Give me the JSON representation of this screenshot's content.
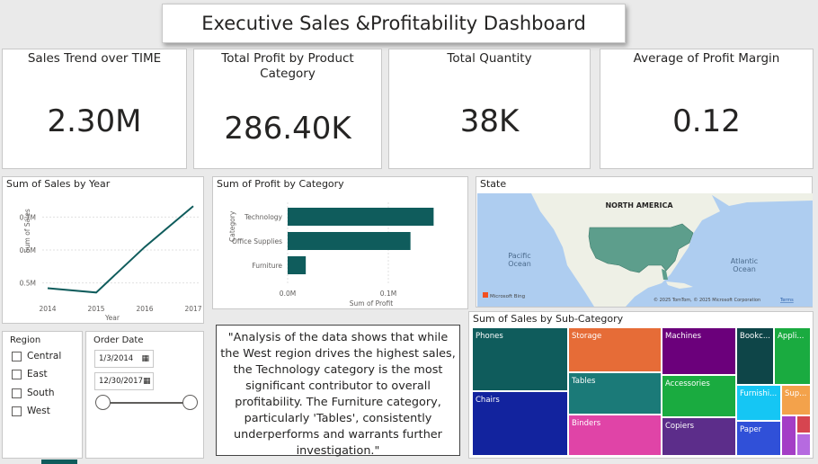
{
  "header": {
    "title": "Executive Sales &Profitability Dashboard"
  },
  "kpis": [
    {
      "label": "Sales Trend over TIME",
      "value": "2.30M"
    },
    {
      "label": "Total Profit by Product Category",
      "value": "286.40K"
    },
    {
      "label": "Total Quantity",
      "value": "38K"
    },
    {
      "label": "Average of Profit Margin",
      "value": "0.12"
    }
  ],
  "line_chart": {
    "title": "Sum of Sales by Year",
    "xlabel": "Year",
    "ylabel": "Sum of Sales",
    "y_ticks": [
      "0.7M",
      "0.6M",
      "0.5M"
    ],
    "x_ticks": [
      "2014",
      "2015",
      "2016",
      "2017"
    ],
    "color": "#0f5c5c"
  },
  "bar_chart": {
    "title": "Sum of Profit by Category",
    "xlabel": "Sum of Profit",
    "ylabel": "Category",
    "x_ticks": [
      "0.0M",
      "0.1M"
    ],
    "color": "#0f5c5c"
  },
  "map": {
    "title": "State",
    "labels": {
      "continent": "NORTH AMERICA",
      "pacific": "Pacific\nOcean",
      "atlantic": "Atlantic\nOcean"
    },
    "pacific_1": "Pacific",
    "pacific_2": "Ocean",
    "atlantic_1": "Atlantic",
    "atlantic_2": "Ocean",
    "bing": "Microsoft Bing",
    "copyright": "© 2025 TomTom, © 2025 Microsoft Corporation",
    "terms": "Terms"
  },
  "treemap": {
    "title": "Sum of Sales by Sub-Category",
    "tiles": [
      {
        "label": "Phones",
        "color": "#0f5c5c"
      },
      {
        "label": "Chairs",
        "color": "#12239e"
      },
      {
        "label": "Storage",
        "color": "#e66c37"
      },
      {
        "label": "Tables",
        "color": "#1b7a78"
      },
      {
        "label": "Binders",
        "color": "#e044a7"
      },
      {
        "label": "Machines",
        "color": "#6b007b"
      },
      {
        "label": "Accessories",
        "color": "#1aab40"
      },
      {
        "label": "Copiers",
        "color": "#5c2d8a"
      },
      {
        "label": "Bookc...",
        "color": "#0e4548"
      },
      {
        "label": "Appli...",
        "color": "#1aab40"
      },
      {
        "label": "Furnishi...",
        "color": "#15c6f4"
      },
      {
        "label": "Sup...",
        "color": "#f3a24b"
      },
      {
        "label": "Paper",
        "color": "#3050d8"
      },
      {
        "label": "",
        "color": "#a43ec6"
      },
      {
        "label": "",
        "color": "#d64550"
      }
    ]
  },
  "slicers": {
    "region": {
      "title": "Region",
      "options": [
        "Central",
        "East",
        "South",
        "West"
      ]
    },
    "order_date": {
      "title": "Order Date",
      "start": "1/3/2014",
      "end": "12/30/2017"
    }
  },
  "note": {
    "text": "\"Analysis of the data shows that while the West region drives the highest sales, the Technology category is the most significant contributor to overall profitability. The Furniture category, particularly 'Tables', consistently underperforms and warrants further investigation.\""
  },
  "chart_data": [
    {
      "type": "line",
      "title": "Sum of Sales by Year",
      "xlabel": "Year",
      "ylabel": "Sum of Sales",
      "x": [
        2014,
        2015,
        2016,
        2017
      ],
      "values": [
        484000,
        471000,
        609000,
        733000
      ],
      "ylim": [
        450000,
        750000
      ]
    },
    {
      "type": "bar",
      "title": "Sum of Profit by Category",
      "xlabel": "Sum of Profit",
      "ylabel": "Category",
      "categories": [
        "Technology",
        "Office Supplies",
        "Furniture"
      ],
      "values": [
        145000,
        122000,
        18000
      ],
      "xlim": [
        0,
        150000
      ]
    },
    {
      "type": "treemap",
      "title": "Sum of Sales by Sub-Category",
      "categories": [
        "Phones",
        "Chairs",
        "Storage",
        "Tables",
        "Binders",
        "Machines",
        "Accessories",
        "Copiers",
        "Bookc...",
        "Appli...",
        "Furnishi...",
        "Sup...",
        "Paper"
      ]
    }
  ]
}
